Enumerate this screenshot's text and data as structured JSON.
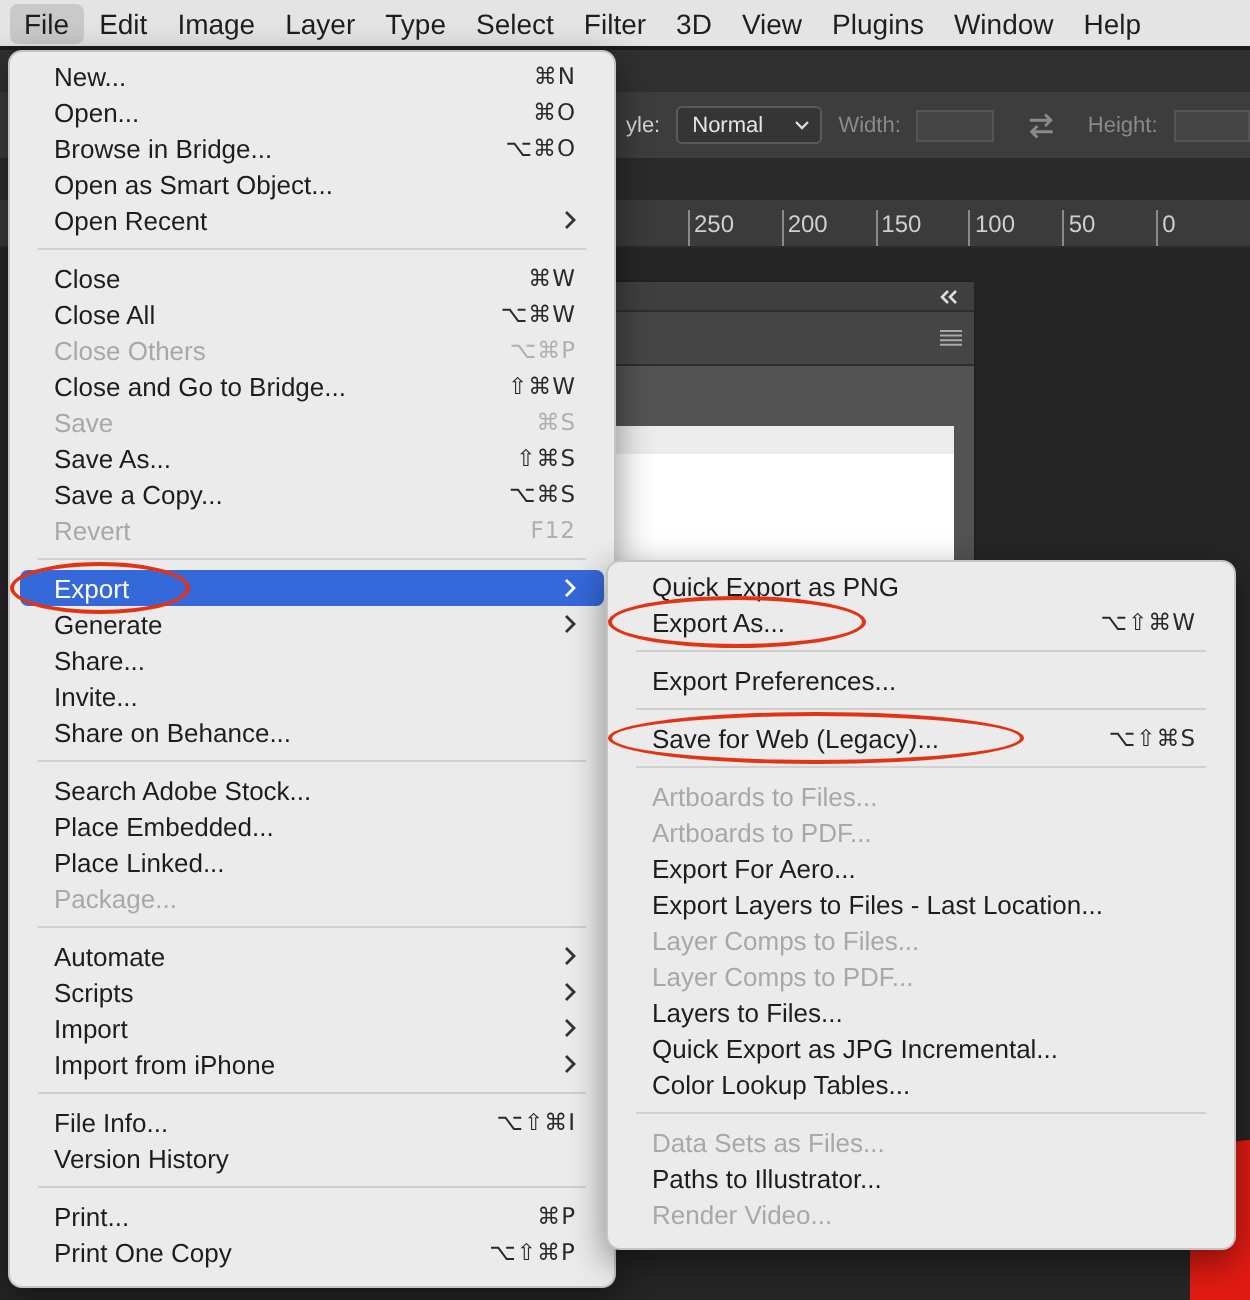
{
  "menu_bar": [
    {
      "label": "File",
      "selected": true
    },
    {
      "label": "Edit",
      "selected": false
    },
    {
      "label": "Image",
      "selected": false
    },
    {
      "label": "Layer",
      "selected": false
    },
    {
      "label": "Type",
      "selected": false
    },
    {
      "label": "Select",
      "selected": false
    },
    {
      "label": "Filter",
      "selected": false
    },
    {
      "label": "3D",
      "selected": false
    },
    {
      "label": "View",
      "selected": false
    },
    {
      "label": "Plugins",
      "selected": false
    },
    {
      "label": "Window",
      "selected": false
    },
    {
      "label": "Help",
      "selected": false
    }
  ],
  "options_bar": {
    "style_label": "yle:",
    "style_value": "Normal",
    "width_label": "Width:",
    "height_label": "Height:"
  },
  "ruler": [
    "250",
    "200",
    "150",
    "100",
    "50",
    "0"
  ],
  "file_menu": [
    [
      {
        "label": "New...",
        "shortcut": "⌘N",
        "submenu": false,
        "disabled": false,
        "selected": false,
        "circled": false
      },
      {
        "label": "Open...",
        "shortcut": "⌘O",
        "submenu": false,
        "disabled": false,
        "selected": false,
        "circled": false
      },
      {
        "label": "Browse in Bridge...",
        "shortcut": "⌥⌘O",
        "submenu": false,
        "disabled": false,
        "selected": false,
        "circled": false
      },
      {
        "label": "Open as Smart Object...",
        "submenu": false,
        "disabled": false,
        "selected": false,
        "circled": false
      },
      {
        "label": "Open Recent",
        "submenu": true,
        "disabled": false,
        "selected": false,
        "circled": false
      }
    ],
    [
      {
        "label": "Close",
        "shortcut": "⌘W",
        "submenu": false,
        "disabled": false,
        "selected": false,
        "circled": false
      },
      {
        "label": "Close All",
        "shortcut": "⌥⌘W",
        "submenu": false,
        "disabled": false,
        "selected": false,
        "circled": false
      },
      {
        "label": "Close Others",
        "shortcut": "⌥⌘P",
        "submenu": false,
        "disabled": true,
        "selected": false,
        "circled": false
      },
      {
        "label": "Close and Go to Bridge...",
        "shortcut": "⇧⌘W",
        "submenu": false,
        "disabled": false,
        "selected": false,
        "circled": false
      },
      {
        "label": "Save",
        "shortcut": "⌘S",
        "submenu": false,
        "disabled": true,
        "selected": false,
        "circled": false
      },
      {
        "label": "Save As...",
        "shortcut": "⇧⌘S",
        "submenu": false,
        "disabled": false,
        "selected": false,
        "circled": false
      },
      {
        "label": "Save a Copy...",
        "shortcut": "⌥⌘S",
        "submenu": false,
        "disabled": false,
        "selected": false,
        "circled": false
      },
      {
        "label": "Revert",
        "shortcut": "F12",
        "submenu": false,
        "disabled": true,
        "selected": false,
        "circled": false
      }
    ],
    [
      {
        "label": "Export",
        "submenu": true,
        "disabled": false,
        "selected": true,
        "circled": true
      },
      {
        "label": "Generate",
        "submenu": true,
        "disabled": false,
        "selected": false,
        "circled": false
      },
      {
        "label": "Share...",
        "submenu": false,
        "disabled": false,
        "selected": false,
        "circled": false
      },
      {
        "label": "Invite...",
        "submenu": false,
        "disabled": false,
        "selected": false,
        "circled": false
      },
      {
        "label": "Share on Behance...",
        "submenu": false,
        "disabled": false,
        "selected": false,
        "circled": false
      }
    ],
    [
      {
        "label": "Search Adobe Stock...",
        "submenu": false,
        "disabled": false,
        "selected": false,
        "circled": false
      },
      {
        "label": "Place Embedded...",
        "submenu": false,
        "disabled": false,
        "selected": false,
        "circled": false
      },
      {
        "label": "Place Linked...",
        "submenu": false,
        "disabled": false,
        "selected": false,
        "circled": false
      },
      {
        "label": "Package...",
        "submenu": false,
        "disabled": true,
        "selected": false,
        "circled": false
      }
    ],
    [
      {
        "label": "Automate",
        "submenu": true,
        "disabled": false,
        "selected": false,
        "circled": false
      },
      {
        "label": "Scripts",
        "submenu": true,
        "disabled": false,
        "selected": false,
        "circled": false
      },
      {
        "label": "Import",
        "submenu": true,
        "disabled": false,
        "selected": false,
        "circled": false
      },
      {
        "label": "Import from iPhone",
        "submenu": true,
        "disabled": false,
        "selected": false,
        "circled": false
      }
    ],
    [
      {
        "label": "File Info...",
        "shortcut": "⌥⇧⌘I",
        "submenu": false,
        "disabled": false,
        "selected": false,
        "circled": false
      },
      {
        "label": "Version History",
        "submenu": false,
        "disabled": false,
        "selected": false,
        "circled": false
      }
    ],
    [
      {
        "label": "Print...",
        "shortcut": "⌘P",
        "submenu": false,
        "disabled": false,
        "selected": false,
        "circled": false
      },
      {
        "label": "Print One Copy",
        "shortcut": "⌥⇧⌘P",
        "submenu": false,
        "disabled": false,
        "selected": false,
        "circled": false
      }
    ]
  ],
  "export_submenu": [
    [
      {
        "label": "Quick Export as PNG",
        "submenu": false,
        "disabled": false,
        "selected": false,
        "circled": false
      },
      {
        "label": "Export As...",
        "shortcut": "⌥⇧⌘W",
        "submenu": false,
        "disabled": false,
        "selected": false,
        "circled": true
      }
    ],
    [
      {
        "label": "Export Preferences...",
        "submenu": false,
        "disabled": false,
        "selected": false,
        "circled": false
      }
    ],
    [
      {
        "label": "Save for Web (Legacy)...",
        "shortcut": "⌥⇧⌘S",
        "submenu": false,
        "disabled": false,
        "selected": false,
        "circled": true
      }
    ],
    [
      {
        "label": "Artboards to Files...",
        "submenu": false,
        "disabled": true,
        "selected": false,
        "circled": false
      },
      {
        "label": "Artboards to PDF...",
        "submenu": false,
        "disabled": true,
        "selected": false,
        "circled": false
      },
      {
        "label": "Export For Aero...",
        "submenu": false,
        "disabled": false,
        "selected": false,
        "circled": false
      },
      {
        "label": "Export Layers to Files - Last Location...",
        "submenu": false,
        "disabled": false,
        "selected": false,
        "circled": false
      },
      {
        "label": "Layer Comps to Files...",
        "submenu": false,
        "disabled": true,
        "selected": false,
        "circled": false
      },
      {
        "label": "Layer Comps to PDF...",
        "submenu": false,
        "disabled": true,
        "selected": false,
        "circled": false
      },
      {
        "label": "Layers to Files...",
        "submenu": false,
        "disabled": false,
        "selected": false,
        "circled": false
      },
      {
        "label": "Quick Export as JPG Incremental...",
        "submenu": false,
        "disabled": false,
        "selected": false,
        "circled": false
      },
      {
        "label": "Color Lookup Tables...",
        "submenu": false,
        "disabled": false,
        "selected": false,
        "circled": false
      }
    ],
    [
      {
        "label": "Data Sets as Files...",
        "submenu": false,
        "disabled": true,
        "selected": false,
        "circled": false
      },
      {
        "label": "Paths to Illustrator...",
        "submenu": false,
        "disabled": false,
        "selected": false,
        "circled": false
      },
      {
        "label": "Render Video...",
        "submenu": false,
        "disabled": true,
        "selected": false,
        "circled": false
      }
    ]
  ]
}
